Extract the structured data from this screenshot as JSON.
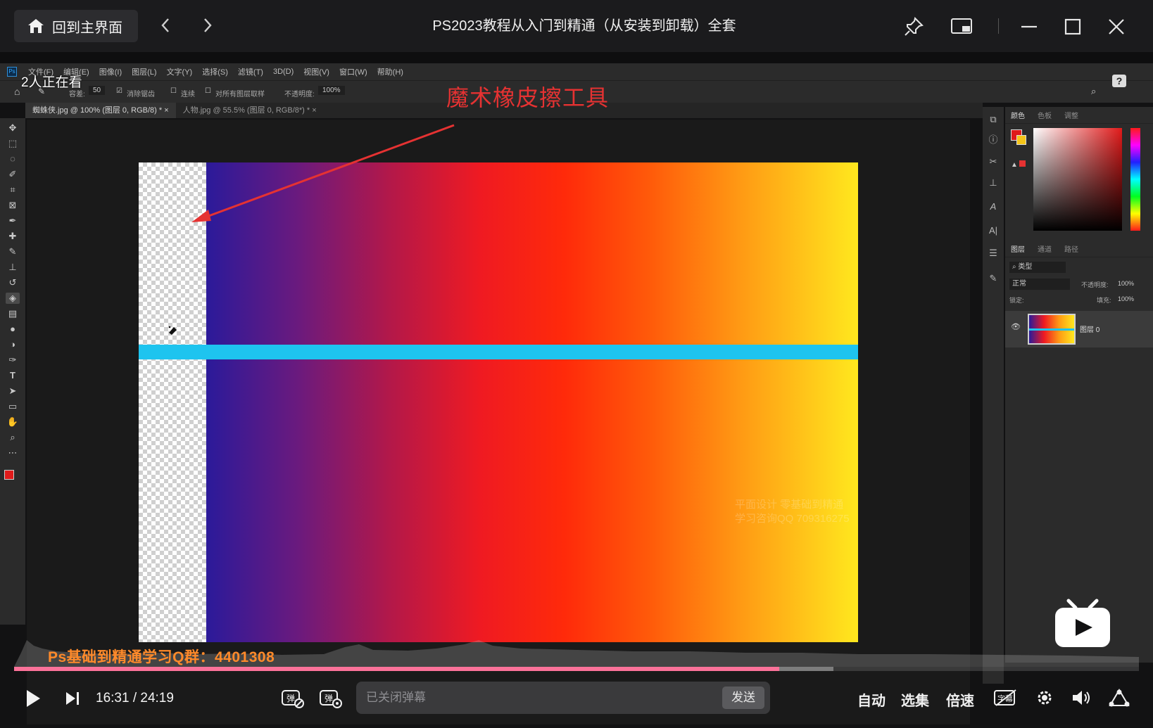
{
  "topbar": {
    "home_label": "回到主界面",
    "title": "PS2023教程从入门到精通（从安装到卸载）全套"
  },
  "video": {
    "viewers": "2人正在看",
    "annotation": "魔术橡皮擦工具",
    "watermark_line1": "平面设计 零基础到精通",
    "watermark_line2": "学习咨询QQ 709316275",
    "qq_group": "Ps基础到精通学习Q群：4401308",
    "ps_menu": [
      "文件(F)",
      "编辑(E)",
      "图像(I)",
      "图层(L)",
      "文字(Y)",
      "选择(S)",
      "滤镜(T)",
      "3D(D)",
      "视图(V)",
      "窗口(W)",
      "帮助(H)"
    ],
    "ps_tabs": [
      "蜘蛛侠.jpg @ 100% (图层 0, RGB/8) *",
      "人物.jpg @ 55.5% (图层 0, RGB/8*) *"
    ],
    "ps_options": {
      "tolerance_label": "容差:",
      "tolerance_value": "50",
      "antialias": "消除锯齿",
      "contiguous": "连续",
      "sample_all": "对所有图层取样",
      "opacity_label": "不透明度:",
      "opacity_value": "100%"
    },
    "color_panel_tabs": [
      "颜色",
      "色板",
      "调整"
    ],
    "layer_panel_tabs": [
      "图层",
      "通道",
      "路径"
    ],
    "layer_filter": "类型",
    "blend_mode": "正常",
    "layer_opacity_label": "不透明度:",
    "layer_opacity_value": "100%",
    "lock_label": "锁定:",
    "fill_label": "填充:",
    "fill_value": "100%",
    "layer_name": "图层 0"
  },
  "player": {
    "current_time": "16:31",
    "separator": "/",
    "total_time": "24:19",
    "progress": 0.68,
    "danmaku_placeholder": "已关闭弹幕",
    "send_label": "发送",
    "auto_label": "自动",
    "episodes_label": "选集",
    "speed_label": "倍速"
  },
  "colors": {
    "accent": "#fb7299",
    "annotation": "#e53232",
    "cyan_bar": "#1ec4ef",
    "qq_text": "#ff8a2a"
  }
}
